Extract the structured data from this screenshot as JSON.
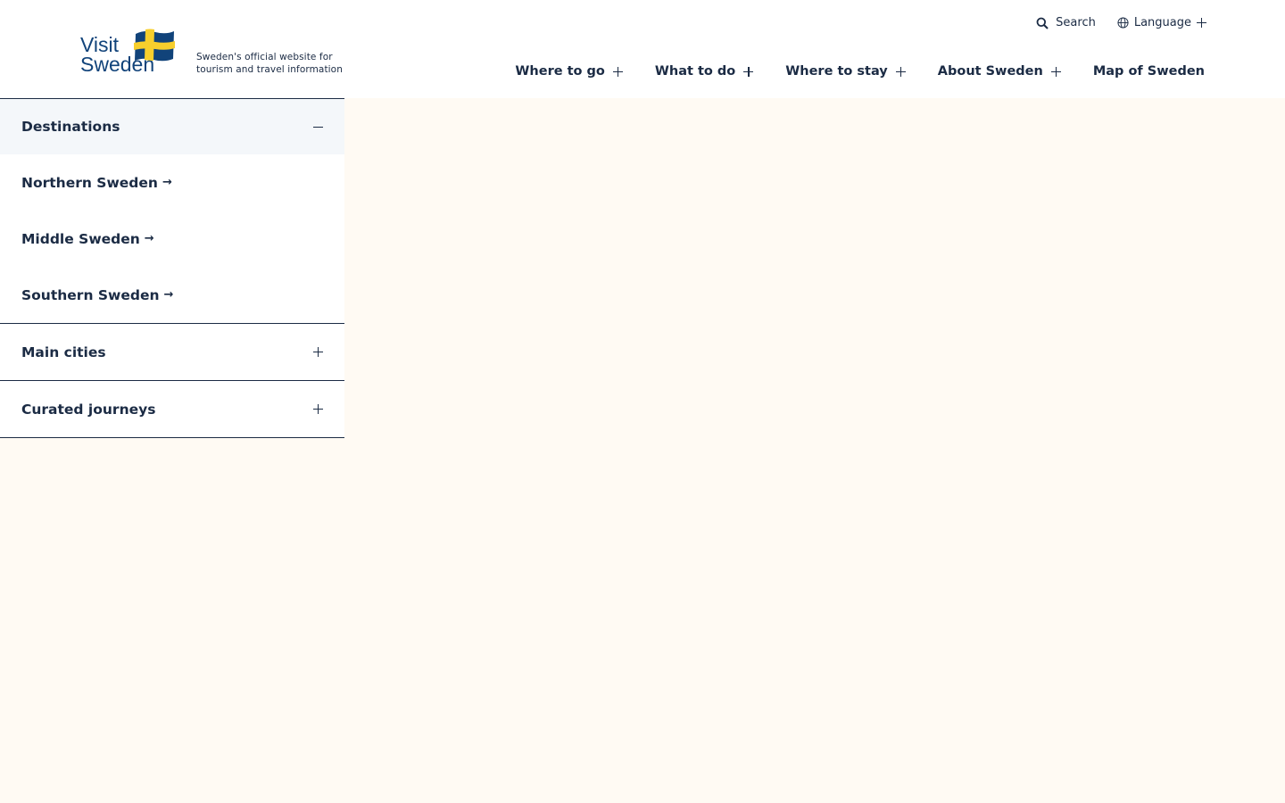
{
  "logo": {
    "line1": "Visit",
    "line2": "Sweden"
  },
  "tagline": "Sweden's official website for tourism and travel information",
  "utility": {
    "search_label": "Search",
    "language_label": "Language"
  },
  "nav": [
    {
      "label": "Where to go",
      "expandable": true
    },
    {
      "label": "What to do",
      "expandable": true
    },
    {
      "label": "Where to stay",
      "expandable": true
    },
    {
      "label": "About Sweden",
      "expandable": true
    },
    {
      "label": "Map of Sweden",
      "expandable": false
    }
  ],
  "sidebar": {
    "open_section": {
      "label": "Destinations",
      "links": [
        {
          "label": "Northern Sweden"
        },
        {
          "label": "Middle Sweden"
        },
        {
          "label": "Southern Sweden"
        }
      ]
    },
    "collapsed_sections": [
      {
        "label": "Main cities"
      },
      {
        "label": "Curated journeys"
      }
    ]
  },
  "colors": {
    "text_navy": "#1b2b44",
    "brand_blue": "#11437a",
    "flag_yellow": "#f7cf2d",
    "page_background": "#fffaf3"
  }
}
